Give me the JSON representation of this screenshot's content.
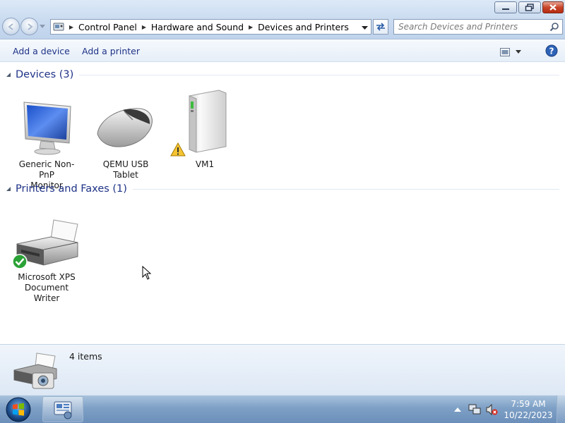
{
  "window": {
    "controls": [
      "minimize-icon",
      "restore-icon",
      "close-icon"
    ]
  },
  "address": {
    "crumbs": [
      "Control Panel",
      "Hardware and Sound",
      "Devices and Printers"
    ]
  },
  "search": {
    "placeholder": "Search Devices and Printers"
  },
  "toolbar": {
    "add_device": "Add a device",
    "add_printer": "Add a printer"
  },
  "groups": [
    {
      "title": "Devices (3)",
      "items": [
        {
          "label_line1": "Generic Non-PnP",
          "label_line2": "Monitor",
          "icon": "monitor-icon"
        },
        {
          "label_line1": "QEMU USB",
          "label_line2": "Tablet",
          "icon": "mouse-icon"
        },
        {
          "label_line1": "VM1",
          "label_line2": "",
          "icon": "computer-tower-icon",
          "badge": "warning-icon"
        }
      ]
    },
    {
      "title": "Printers and Faxes (1)",
      "items": [
        {
          "label_line1": "Microsoft XPS",
          "label_line2": "Document Writer",
          "icon": "printer-icon",
          "badge": "default-check-icon"
        }
      ]
    }
  ],
  "details": {
    "count": "4 items"
  },
  "taskbar": {
    "time": "7:59 AM",
    "date": "10/22/2023"
  },
  "colors": {
    "link_blue": "#1e3287",
    "taskbar": "#7ea0c6"
  }
}
